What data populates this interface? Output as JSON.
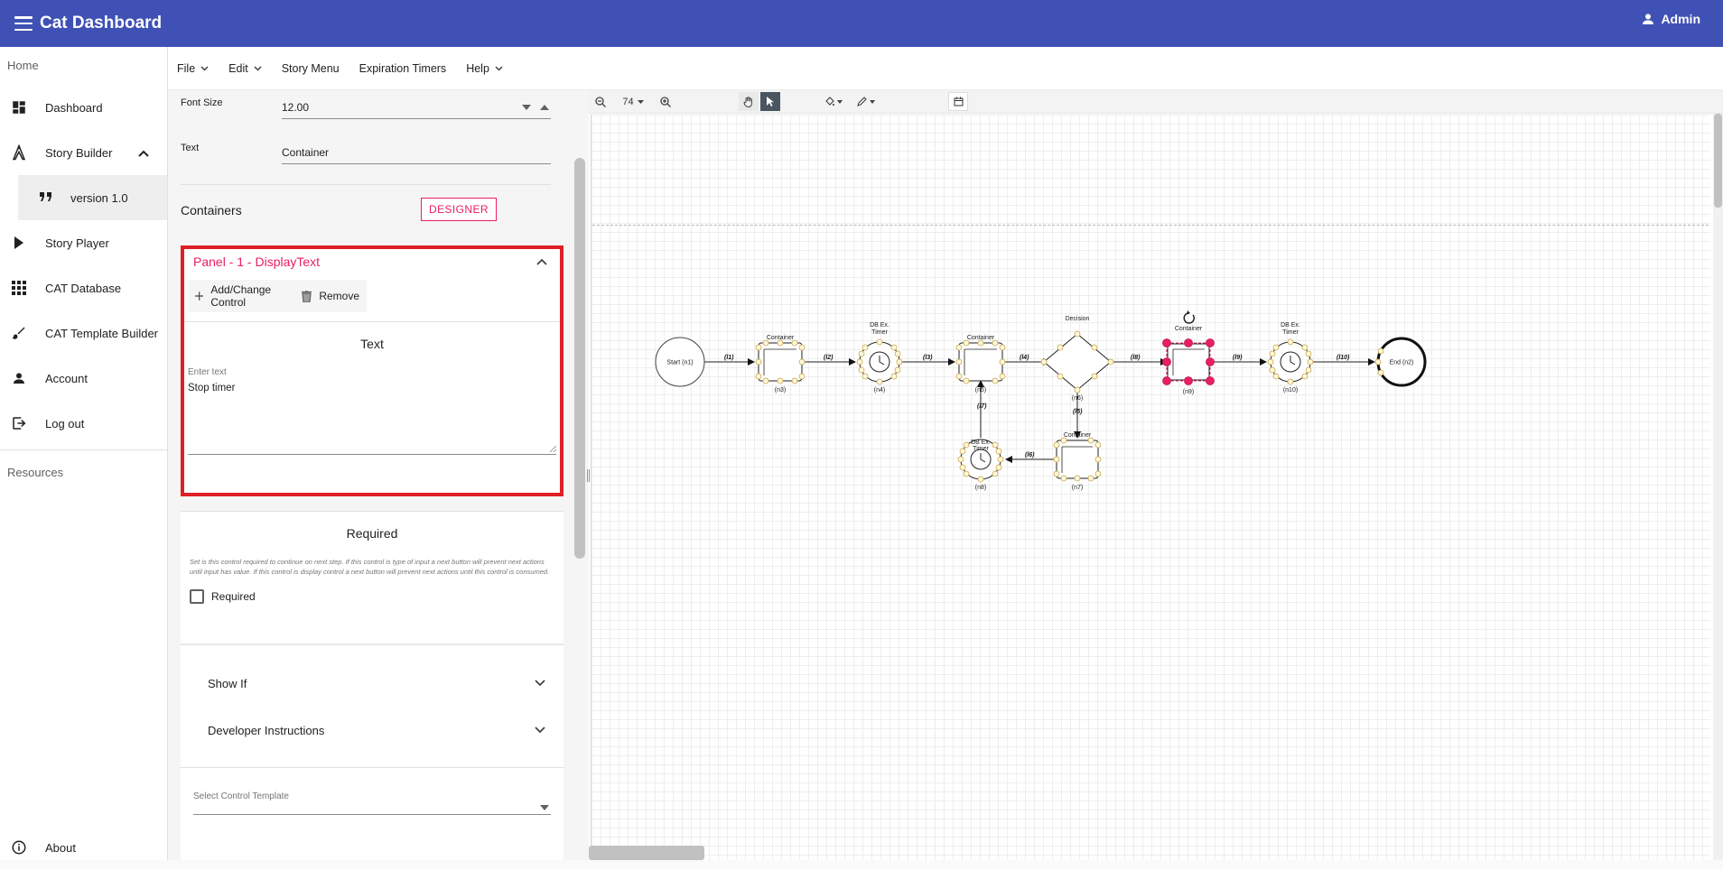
{
  "app": {
    "title": "Cat Dashboard",
    "user": "Admin",
    "colors": {
      "primary": "#3f51b5",
      "accent": "#e91e63",
      "highlight": "#e01f26"
    }
  },
  "sidenav": {
    "section_home": "Home",
    "items": [
      {
        "label": "Dashboard",
        "icon": "dashboard-icon"
      },
      {
        "label": "Story Builder",
        "icon": "compass-icon",
        "expanded": true
      },
      {
        "label": "version 1.0",
        "icon": "quote-icon"
      },
      {
        "label": "Story Player",
        "icon": "play-icon"
      },
      {
        "label": "CAT Database",
        "icon": "apps-grid-icon"
      },
      {
        "label": "CAT Template Builder",
        "icon": "brush-icon"
      },
      {
        "label": "Account",
        "icon": "person-icon"
      },
      {
        "label": "Log out",
        "icon": "logout-icon"
      }
    ],
    "section_resources": "Resources",
    "about": "About"
  },
  "menubar": {
    "file": "File",
    "edit": "Edit",
    "story_menu": "Story Menu",
    "expiration_timers": "Expiration Timers",
    "help": "Help"
  },
  "properties": {
    "font_size_label": "Font Size",
    "font_size_value": "12.00",
    "text_label": "Text",
    "text_value": "Container",
    "containers_label": "Containers",
    "designer_button": "DESIGNER"
  },
  "panel": {
    "title": "Panel - 1 - DisplayText",
    "add_change": "Add/Change Control",
    "remove": "Remove",
    "text_section_title": "Text",
    "textarea_label": "Enter text",
    "textarea_value": "Stop timer"
  },
  "required": {
    "title": "Required",
    "description": "Set is this control required to continue on next step. If this control is type of input a next button will prevent next actions until input has value. If this control is display control a next button will prevent next actions until this control is consumed.",
    "checkbox_label": "Required",
    "checked": false
  },
  "expanders": {
    "show_if": "Show If",
    "developer_instructions": "Developer Instructions"
  },
  "control_template": {
    "label": "Select Control Template"
  },
  "canvas": {
    "zoom": "74",
    "nodes": {
      "start": "Start (n1)",
      "end": "End (n2)",
      "container": "Container",
      "db_timer_1": "DB Ex.",
      "db_timer_2": "Timer",
      "decision": "Decision",
      "n3": "(n3)",
      "n4": "(n4)",
      "n5": "(n5)",
      "n6": "(n6)",
      "n7": "(n7)",
      "n8": "(n8)",
      "n9": "(n9)",
      "n10": "(n10)"
    },
    "links": {
      "l1": "(l1)",
      "l2": "(l2)",
      "l3": "(l3)",
      "l4": "(l4)",
      "l5": "(l5)",
      "l6": "(l6)",
      "l7": "(l7)",
      "l8": "(l8)",
      "l9": "(l9)",
      "l10": "(l10)"
    }
  }
}
